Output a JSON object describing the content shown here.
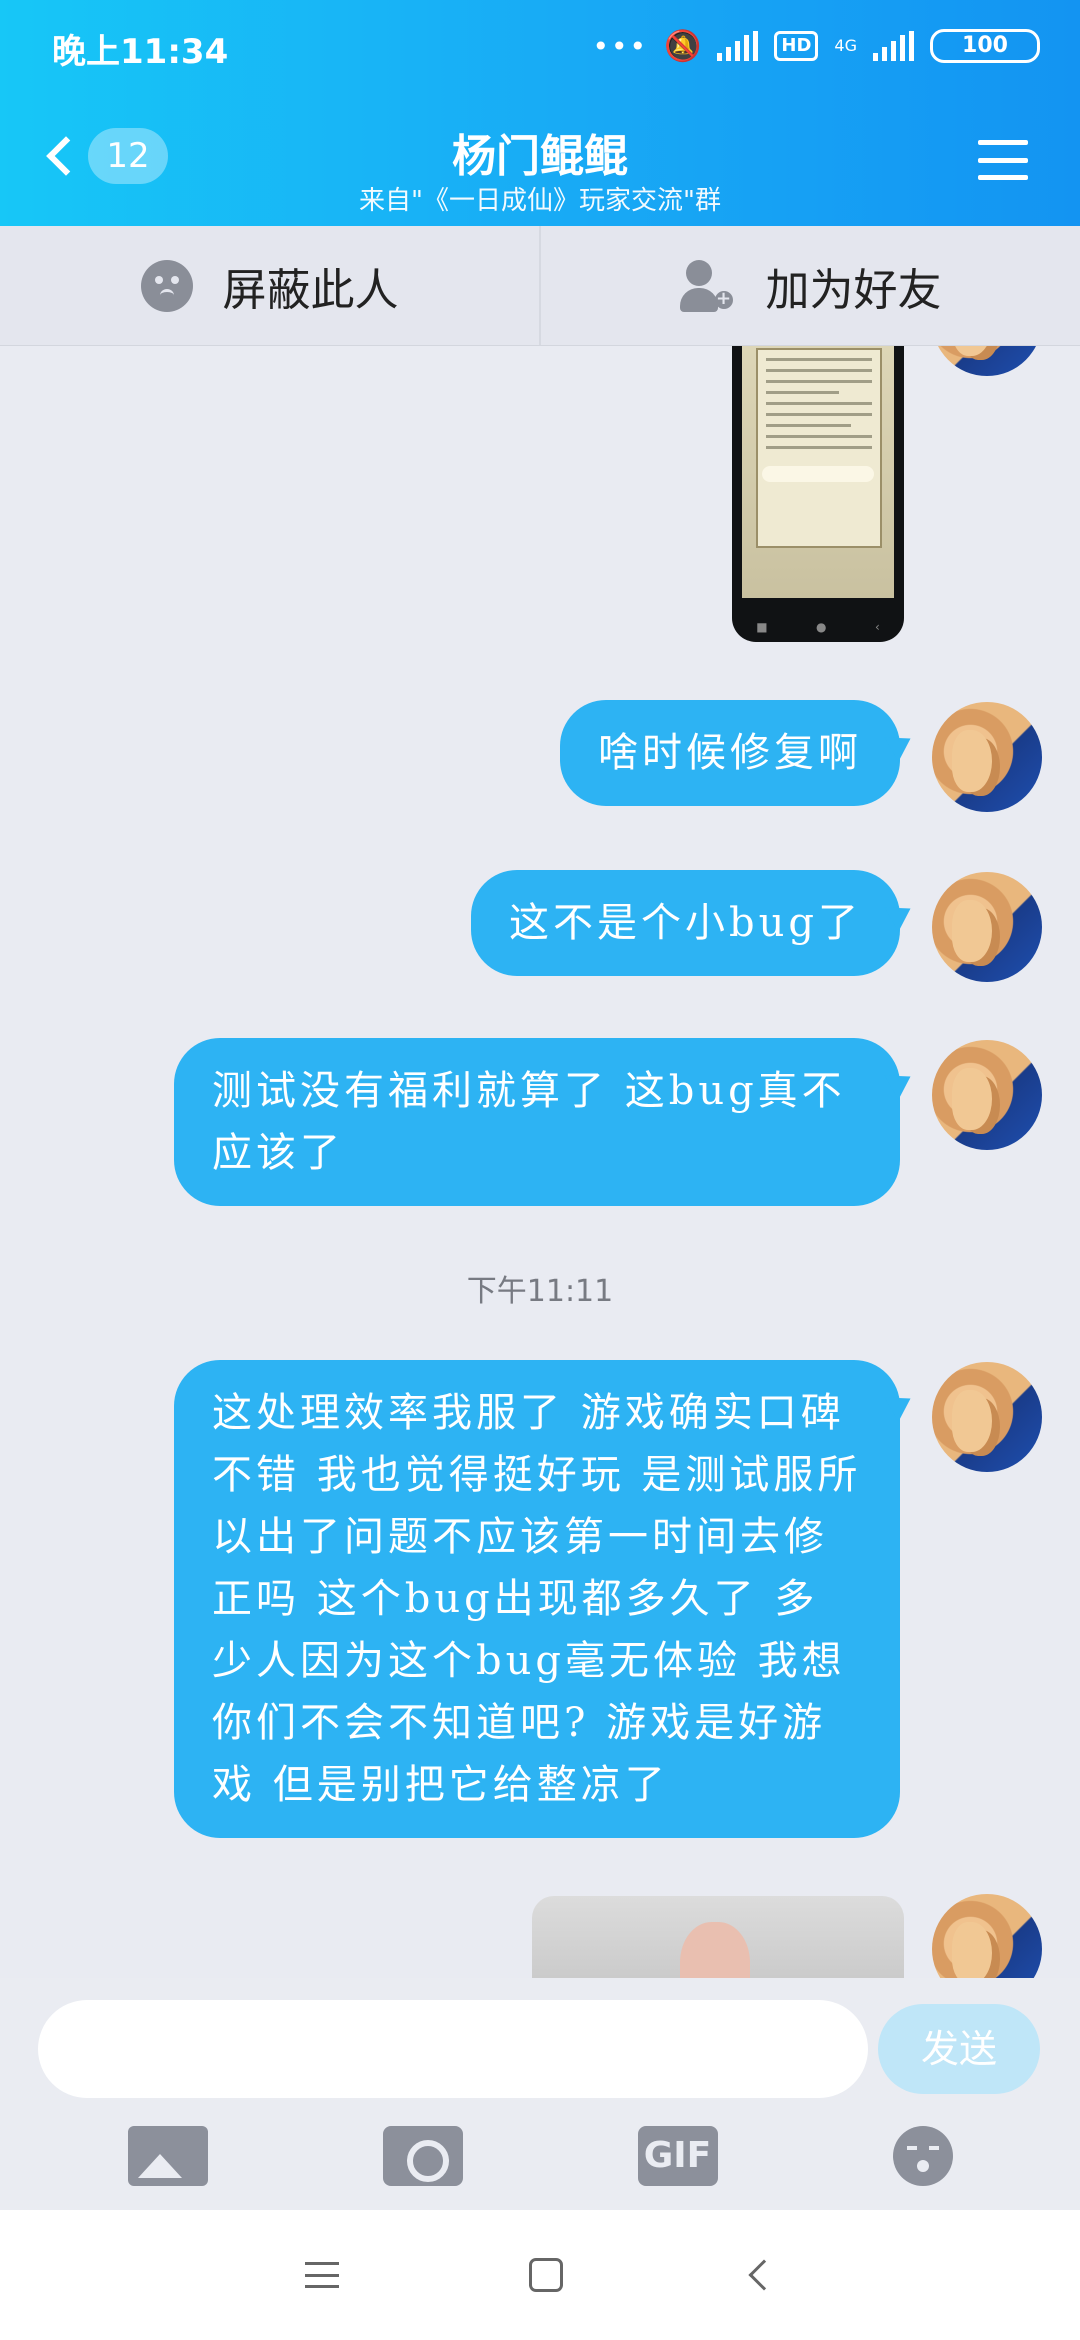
{
  "status_bar": {
    "time": "晚上11:34",
    "hd": "HD",
    "network": "4G",
    "battery": "100",
    "dots": "•••"
  },
  "header": {
    "back_count": "12",
    "title": "杨门鲲鲲",
    "subtitle": "来自\"《一日成仙》玩家交流\"群"
  },
  "actions": {
    "block_label": "屏蔽此人",
    "add_friend_label": "加为好友"
  },
  "messages": [
    {
      "type": "image",
      "desc": ""
    },
    {
      "type": "text",
      "text": "啥时候修复啊"
    },
    {
      "type": "text",
      "text": "这不是个小bug了"
    },
    {
      "type": "text",
      "text": "测试没有福利就算了 这bug真不应该了"
    },
    {
      "type": "timestamp",
      "text": "下午11:11"
    },
    {
      "type": "text",
      "text": "这处理效率我服了 游戏确实口碑不错 我也觉得挺好玩 是测试服所以出了问题不应该第一时间去修正吗 这个bug出现都多久了 多少人因为这个bug毫无体验 我想你们不会不知道吧? 游戏是好游戏 但是别把它给整凉了"
    },
    {
      "type": "image",
      "desc": ""
    }
  ],
  "input": {
    "value": "",
    "send_label": "发送"
  },
  "toolbar": {
    "gif_label": "GIF"
  },
  "colors": {
    "bubble": "#2db3f3",
    "header_start": "#17c7f7",
    "header_end": "#1394f2",
    "send_disabled": "#bfe6f8"
  }
}
